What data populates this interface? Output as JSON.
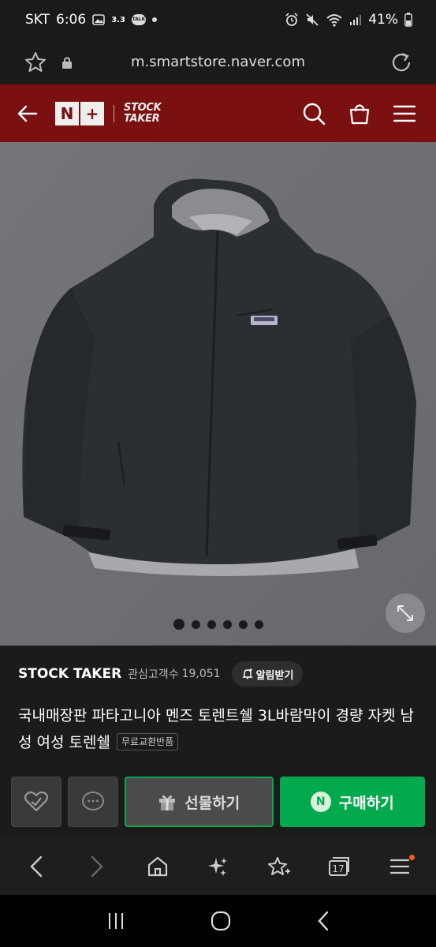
{
  "status": {
    "carrier": "SKT",
    "time": "6:06",
    "net_badge": "3.3",
    "talk_badge": "TALK",
    "battery": "41%"
  },
  "browser": {
    "url": "m.smartstore.naver.com"
  },
  "header": {
    "n_logo": [
      "N",
      "+"
    ],
    "store_logo_line1": "STOCK",
    "store_logo_line2": "TAKER"
  },
  "product": {
    "seller_name": "STOCK TAKER",
    "favorites_label": "관심고객수",
    "favorites_count": "19,051",
    "alert_label": "알림받기",
    "title": "국내매장판 파타고니아 멘즈 토렌트쉘 3L바람막이 경량 자켓 남성 여성 토렌쉘",
    "tag": "무료교환반품",
    "image_count": 6,
    "current_image": 1
  },
  "actions": {
    "gift_label": "선물하기",
    "buy_label": "구매하기",
    "buy_badge": "N"
  },
  "browser_toolbar": {
    "tab_count": "17"
  },
  "colors": {
    "header_bg": "#7a1010",
    "naver_green": "#03a94d",
    "image_bg": "#6f6f73"
  }
}
